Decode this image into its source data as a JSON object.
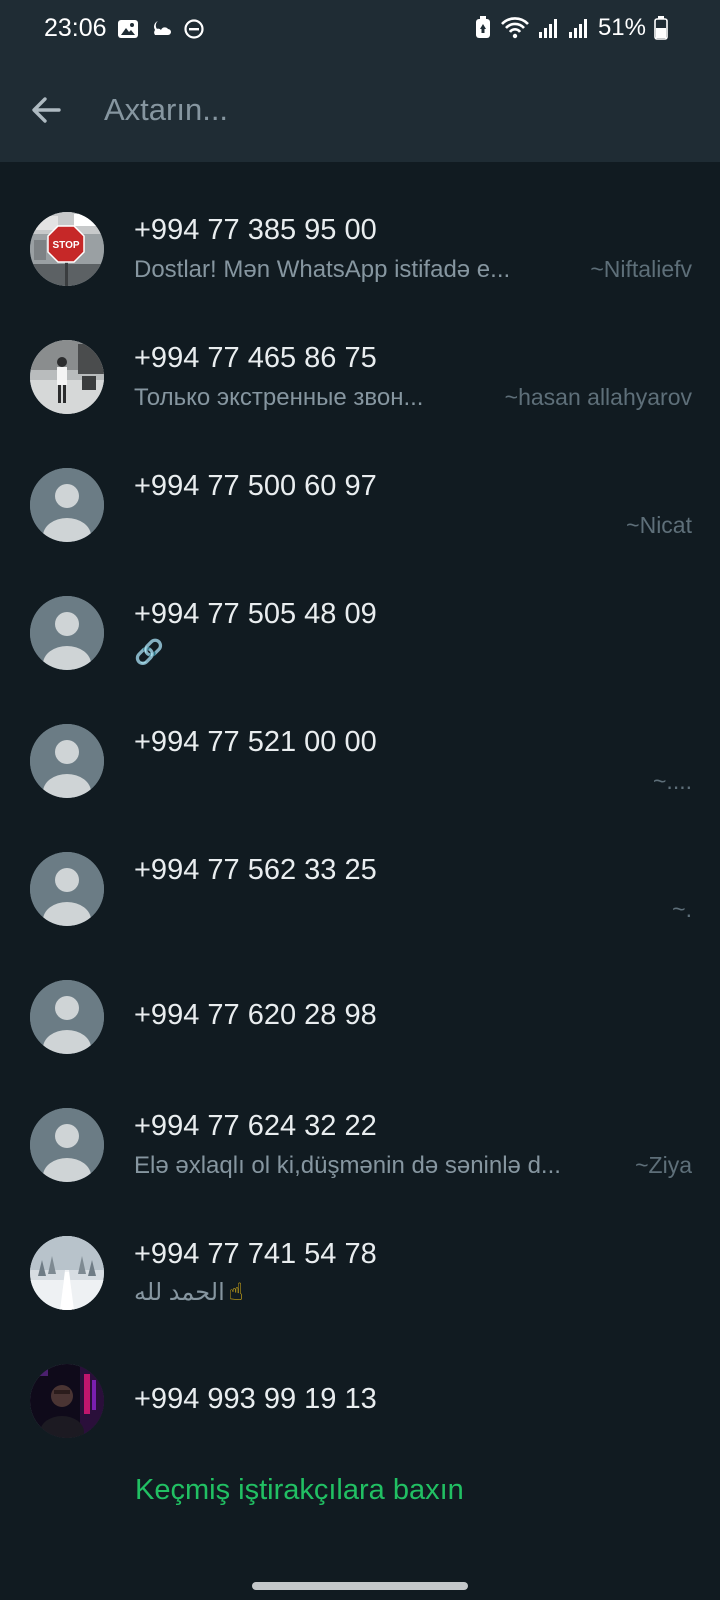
{
  "status_bar": {
    "time": "23:06",
    "battery": "51%",
    "icons_left": [
      "gallery-icon",
      "weather-icon",
      "do-not-disturb-icon"
    ],
    "icons_right": [
      "battery-saver-icon",
      "wifi-icon",
      "signal-icon",
      "signal-icon",
      "battery-icon"
    ]
  },
  "search": {
    "placeholder": "Axtarın...",
    "value": ""
  },
  "colors": {
    "background": "#111b21",
    "header": "#1f2c34",
    "accent": "#21c063",
    "secondary_text": "#8696a0"
  },
  "contacts": [
    {
      "number": "+994 77 385 95 00",
      "status": "Dostlar! Mən WhatsApp istifadə e...",
      "pushname": "~Niftaliefv",
      "avatar": "photo-stop-sign"
    },
    {
      "number": "+994 77 465 86 75",
      "status": "Только экстренные звон...",
      "pushname": "~hasan allahyarov",
      "avatar": "photo-person-bw"
    },
    {
      "number": "+994 77 500 60 97",
      "status": "",
      "pushname": "~Nicat",
      "avatar": "default"
    },
    {
      "number": "+994 77 505 48 09",
      "status": "🔗",
      "pushname": "",
      "avatar": "default"
    },
    {
      "number": "+994 77 521 00 00",
      "status": "",
      "pushname": "~....",
      "avatar": "default"
    },
    {
      "number": "+994 77 562 33 25",
      "status": "",
      "pushname": "~.",
      "avatar": "default"
    },
    {
      "number": "+994 77 620 28 98",
      "status": "",
      "pushname": "",
      "avatar": "default"
    },
    {
      "number": "+994 77 624 32 22",
      "status": "Elə əxlaqlı ol ki,düşmənin də səninlə d...",
      "pushname": "~Ziya",
      "avatar": "default"
    },
    {
      "number": "+994 77 741 54 78",
      "status": "الحمد لله",
      "status_emoji": "☝",
      "pushname": "",
      "avatar": "photo-snow-road"
    },
    {
      "number": "+994 993 99 19 13",
      "status": "",
      "pushname": "",
      "avatar": "photo-person-neon"
    }
  ],
  "footer": {
    "link_label": "Keçmiş iştirakçılara baxın"
  }
}
